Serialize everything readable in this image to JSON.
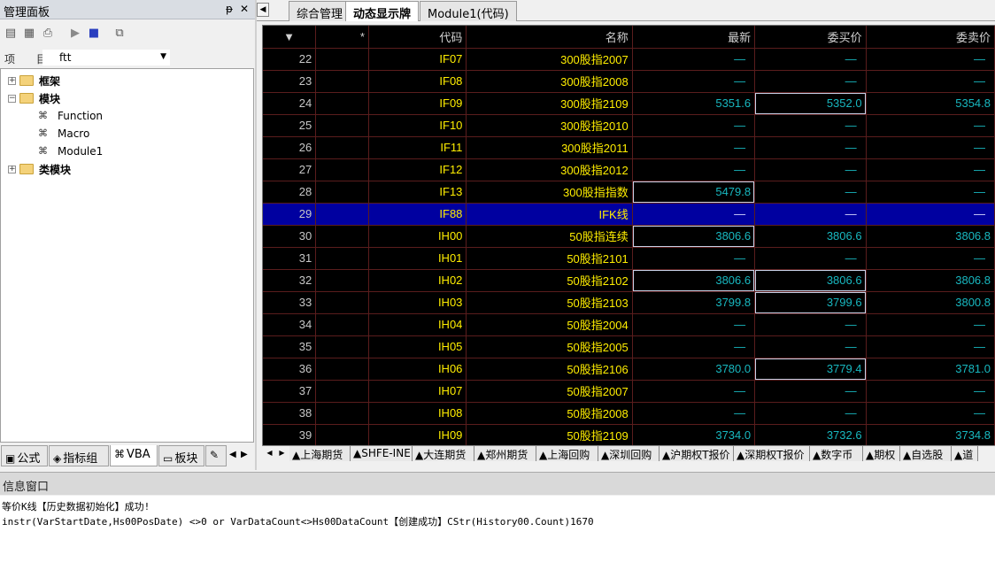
{
  "left_panel": {
    "title": "管理面板",
    "pin_icon": "pin-icon",
    "close_icon": "close-icon",
    "toolbar_icons": [
      "properties-icon",
      "layout-icon",
      "print-icon",
      "run-icon",
      "stop-icon",
      "export-icon"
    ],
    "project_label": "项 目",
    "project_value": "ftt",
    "tree": [
      {
        "label": "框架",
        "type": "folder",
        "bold": true,
        "expander": "+"
      },
      {
        "label": "模块",
        "type": "folder",
        "bold": true,
        "expander": "−"
      },
      {
        "label": "Function",
        "type": "module"
      },
      {
        "label": "Macro",
        "type": "module"
      },
      {
        "label": "Module1",
        "type": "module"
      },
      {
        "label": "类模块",
        "type": "folder",
        "bold": true,
        "expander": "+"
      }
    ],
    "bottom_tabs": [
      {
        "label": "公式",
        "icon": "formula-icon"
      },
      {
        "label": "指标组",
        "icon": "indicator-group-icon"
      },
      {
        "label": "VBA",
        "icon": "vba-icon"
      },
      {
        "label": "板块",
        "icon": "block-icon"
      },
      {
        "label": "",
        "icon": "pencil-icon"
      }
    ]
  },
  "doc_tabs": [
    {
      "label": "综合管理"
    },
    {
      "label": "动态显示牌",
      "active": true
    },
    {
      "label": "Module1(代码)"
    }
  ],
  "grid": {
    "headers": [
      "",
      "*",
      "代码",
      "名称",
      "最新",
      "委买价",
      "委卖价"
    ],
    "rows": [
      {
        "num": "22",
        "code": "IF07",
        "name": "300股指2007",
        "last": "—",
        "bid": "—",
        "ask": "—"
      },
      {
        "num": "23",
        "code": "IF08",
        "name": "300股指2008",
        "last": "—",
        "bid": "—",
        "ask": "—"
      },
      {
        "num": "24",
        "code": "IF09",
        "name": "300股指2109",
        "last": "5351.6",
        "bid": "5352.0",
        "ask": "5354.8",
        "boxed": [
          "bid"
        ]
      },
      {
        "num": "25",
        "code": "IF10",
        "name": "300股指2010",
        "last": "—",
        "bid": "—",
        "ask": "—"
      },
      {
        "num": "26",
        "code": "IF11",
        "name": "300股指2011",
        "last": "—",
        "bid": "—",
        "ask": "—"
      },
      {
        "num": "27",
        "code": "IF12",
        "name": "300股指2012",
        "last": "—",
        "bid": "—",
        "ask": "—"
      },
      {
        "num": "28",
        "code": "IF13",
        "name": "300股指指数",
        "last": "5479.8",
        "bid": "—",
        "ask": "—",
        "boxed": [
          "last"
        ]
      },
      {
        "num": "29",
        "code": "IF88",
        "name": "IFK线",
        "last": "—",
        "bid": "—",
        "ask": "—",
        "selected": true
      },
      {
        "num": "30",
        "code": "IH00",
        "name": "50股指连续",
        "last": "3806.6",
        "bid": "3806.6",
        "ask": "3806.8",
        "boxed": [
          "last"
        ]
      },
      {
        "num": "31",
        "code": "IH01",
        "name": "50股指2101",
        "last": "—",
        "bid": "—",
        "ask": "—"
      },
      {
        "num": "32",
        "code": "IH02",
        "name": "50股指2102",
        "last": "3806.6",
        "bid": "3806.6",
        "ask": "3806.8",
        "boxed": [
          "last",
          "bid"
        ]
      },
      {
        "num": "33",
        "code": "IH03",
        "name": "50股指2103",
        "last": "3799.8",
        "bid": "3799.6",
        "ask": "3800.8",
        "boxed": [
          "bid"
        ]
      },
      {
        "num": "34",
        "code": "IH04",
        "name": "50股指2004",
        "last": "—",
        "bid": "—",
        "ask": "—"
      },
      {
        "num": "35",
        "code": "IH05",
        "name": "50股指2005",
        "last": "—",
        "bid": "—",
        "ask": "—"
      },
      {
        "num": "36",
        "code": "IH06",
        "name": "50股指2106",
        "last": "3780.0",
        "bid": "3779.4",
        "ask": "3781.0",
        "boxed": [
          "bid"
        ]
      },
      {
        "num": "37",
        "code": "IH07",
        "name": "50股指2007",
        "last": "—",
        "bid": "—",
        "ask": "—"
      },
      {
        "num": "38",
        "code": "IH08",
        "name": "50股指2008",
        "last": "—",
        "bid": "—",
        "ask": "—"
      },
      {
        "num": "39",
        "code": "IH09",
        "name": "50股指2109",
        "last": "3734.0",
        "bid": "3732.6",
        "ask": "3734.8"
      }
    ]
  },
  "market_tabs": [
    "▲上海期货",
    "▲SHFE-INE",
    "▲大连期货",
    "▲郑州期货",
    "▲上海回购",
    "▲深圳回购",
    "▲沪期权T报价",
    "▲深期权T报价",
    "▲数字币",
    "▲期权",
    "▲自选股",
    "▲道"
  ],
  "info_window": {
    "title": "信息窗口",
    "lines": [
      "等价K线【历史数据初始化】成功!",
      "instr(VarStartDate,Hs00PosDate) <>0 or VarDataCount<>Hs00DataCount【创建成功】CStr(History00.Count)1670"
    ]
  },
  "colors": {
    "grid_bg": "#000000",
    "code_text": "#ffee00",
    "price_text": "#18b8c0",
    "selected_row": "#0000a0",
    "grid_line": "#5a1d1d"
  }
}
